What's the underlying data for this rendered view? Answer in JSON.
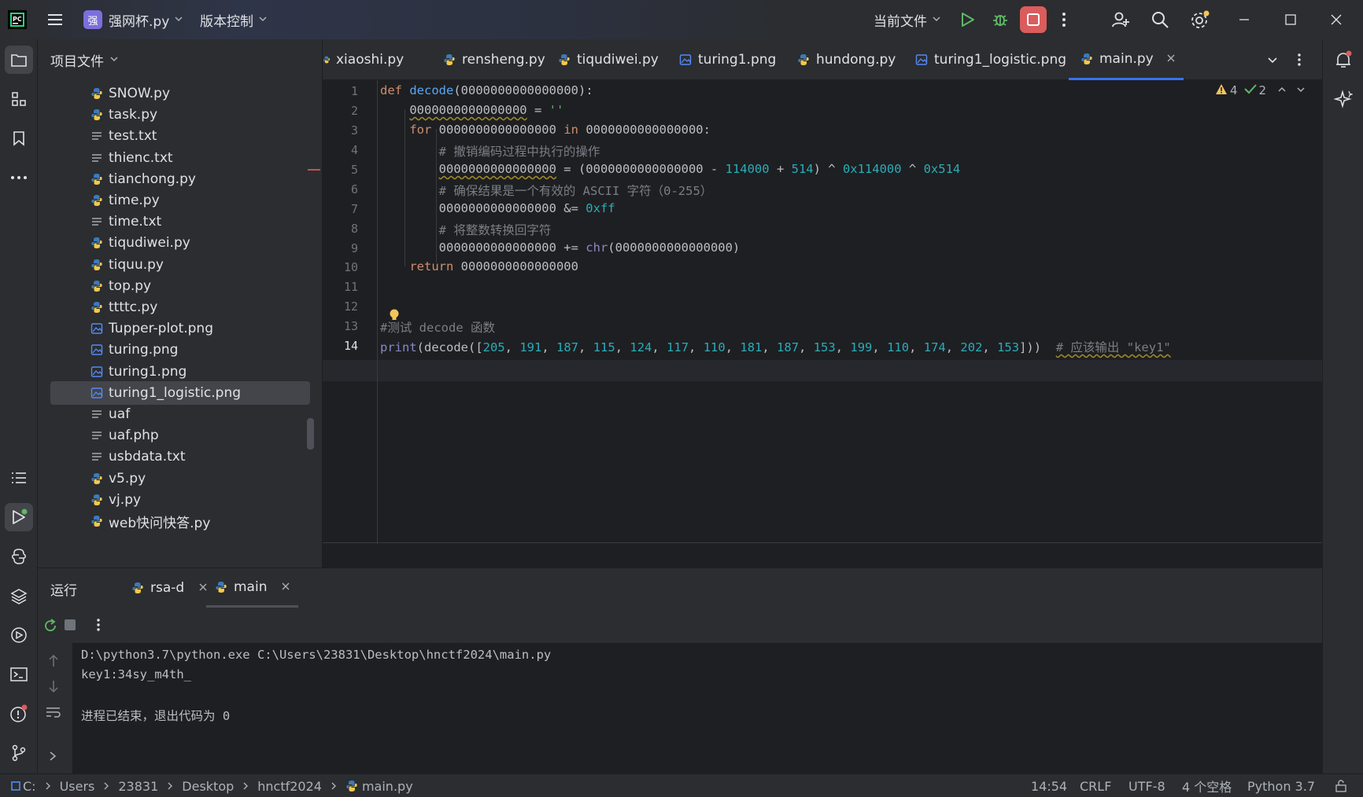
{
  "titlebar": {
    "project": "强网杯.py",
    "project_badge": "强",
    "vcs": "版本控制",
    "run_config": "当前文件"
  },
  "project_panel": {
    "title": "项目文件",
    "files": [
      {
        "name": "SNOW.py",
        "kind": "py"
      },
      {
        "name": "task.py",
        "kind": "py"
      },
      {
        "name": "test.txt",
        "kind": "txt"
      },
      {
        "name": "thienc.txt",
        "kind": "txt"
      },
      {
        "name": "tianchong.py",
        "kind": "py"
      },
      {
        "name": "time.py",
        "kind": "py"
      },
      {
        "name": "time.txt",
        "kind": "txt"
      },
      {
        "name": "tiqudiwei.py",
        "kind": "py"
      },
      {
        "name": "tiquu.py",
        "kind": "py"
      },
      {
        "name": "top.py",
        "kind": "py"
      },
      {
        "name": "ttttc.py",
        "kind": "py"
      },
      {
        "name": "Tupper-plot.png",
        "kind": "png"
      },
      {
        "name": "turing.png",
        "kind": "png"
      },
      {
        "name": "turing1.png",
        "kind": "png"
      },
      {
        "name": "turing1_logistic.png",
        "kind": "png",
        "selected": true
      },
      {
        "name": "uaf",
        "kind": "txt"
      },
      {
        "name": "uaf.php",
        "kind": "txt"
      },
      {
        "name": "usbdata.txt",
        "kind": "txt"
      },
      {
        "name": "v5.py",
        "kind": "py"
      },
      {
        "name": "vj.py",
        "kind": "py"
      },
      {
        "name": "web快问快答.py",
        "kind": "py"
      }
    ]
  },
  "editor_tabs": [
    {
      "name": "xiaoshi.py",
      "kind": "py"
    },
    {
      "name": "rensheng.py",
      "kind": "py"
    },
    {
      "name": "tiqudiwei.py",
      "kind": "py"
    },
    {
      "name": "turing1.png",
      "kind": "png"
    },
    {
      "name": "hundong.py",
      "kind": "py"
    },
    {
      "name": "turing1_logistic.png",
      "kind": "png"
    },
    {
      "name": "main.py",
      "kind": "py",
      "active": true
    }
  ],
  "inspections": {
    "warnings": "4",
    "ok": "2"
  },
  "code": {
    "line_numbers": [
      "1",
      "2",
      "3",
      "4",
      "5",
      "6",
      "7",
      "8",
      "9",
      "10",
      "11",
      "12",
      "13",
      "14"
    ],
    "l1": {
      "kw": "def",
      "fn": "decode",
      "args": "(0000000000000000)",
      "end": ":"
    },
    "l2": {
      "var": "0000000000000000",
      "op": " = ",
      "str": "''"
    },
    "l3": {
      "kw1": "for",
      "a": " 0000000000000000 ",
      "kw2": "in",
      "b": " 0000000000000000:"
    },
    "l4": "# 撤销编码过程中执行的操作",
    "l5": {
      "var": "0000000000000000",
      "a": " = (0000000000000000 - ",
      "n1": "114000",
      "b": " + ",
      "n2": "514",
      "c": ") ^ ",
      "n3": "0x114000",
      "d": " ^ ",
      "n4": "0x514"
    },
    "l6": "# 确保结果是一个有效的 ASCII 字符（0-255）",
    "l7": {
      "a": "0000000000000000 &= ",
      "n": "0xff"
    },
    "l8": "# 将整数转换回字符",
    "l9": {
      "a": "0000000000000000 += ",
      "bi": "chr",
      "b": "(0000000000000000)"
    },
    "l10": {
      "kw": "return",
      "a": " 0000000000000000"
    },
    "l13": "#测试 decode 函数",
    "l14": {
      "bi": "print",
      "a": "(decode([",
      "nums": [
        "205",
        "191",
        "187",
        "115",
        "124",
        "117",
        "110",
        "181",
        "187",
        "153",
        "199",
        "110",
        "174",
        "202",
        "153"
      ],
      "b": "]))",
      "cm": "# 应该输出 \"key1\""
    }
  },
  "run_panel": {
    "label": "运行",
    "tabs": [
      {
        "name": "rsa-d"
      },
      {
        "name": "main",
        "active": true
      }
    ]
  },
  "console": {
    "lines": [
      "D:\\python3.7\\python.exe C:\\Users\\23831\\Desktop\\hnctf2024\\main.py",
      "key1:34sy_m4th_",
      "",
      "进程已结束，退出代码为 0"
    ]
  },
  "statusbar": {
    "path": [
      "C:",
      "Users",
      "23831",
      "Desktop",
      "hnctf2024",
      "main.py"
    ],
    "position": "14:54",
    "line_sep": "CRLF",
    "encoding": "UTF-8",
    "indent": "4 个空格",
    "interpreter": "Python 3.7"
  },
  "colors": {
    "accent": "#3574f0",
    "bg": "#1e1f22",
    "panel": "#2b2d30",
    "stop_button": "#db5c5c",
    "run_green": "#5fb865"
  }
}
